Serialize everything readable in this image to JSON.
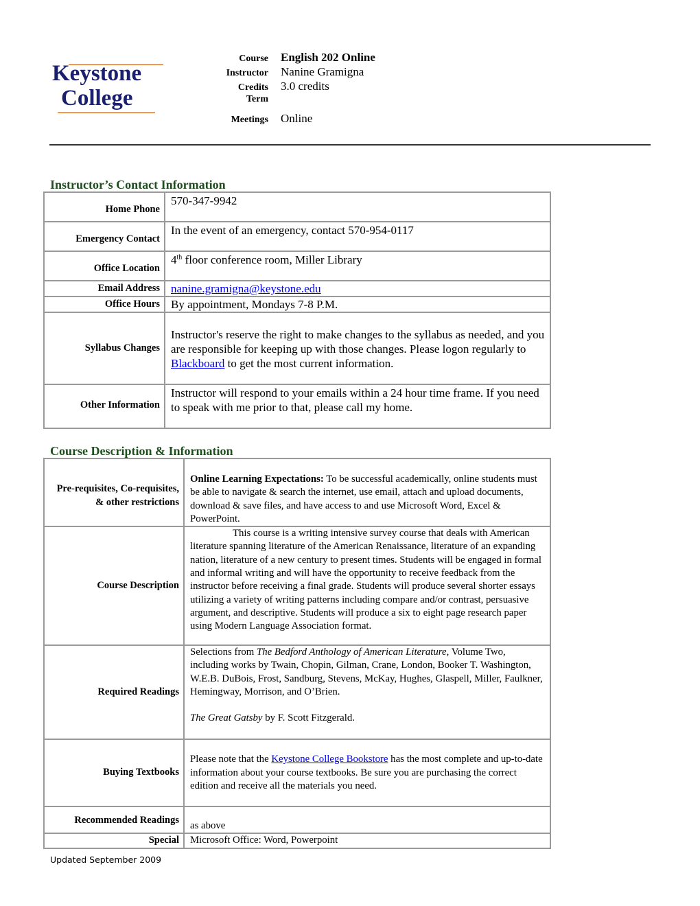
{
  "logo": {
    "line1": "Keystone",
    "line2": "College",
    "text_color": "#1a1f6e",
    "accent_color": "#f79646"
  },
  "course_meta": [
    {
      "label": "Course",
      "value": "English 202 Online"
    },
    {
      "label": "Instructor",
      "value": "Nanine Gramigna"
    },
    {
      "label": "Credits",
      "value": "3.0 credits"
    },
    {
      "label": "Term",
      "value": ""
    },
    {
      "label": "Meetings",
      "value": "Online"
    }
  ],
  "contact_section": {
    "title": "Instructor’s Contact Information",
    "rows": [
      {
        "label": "Home Phone",
        "value": "570-347-9942"
      },
      {
        "label": "Emergency Contact",
        "value": "In the event of an emergency, contact 570-954-0117"
      },
      {
        "label": "Office Location",
        "value_sup": "th",
        "value_pre": "4",
        "value_post": " floor conference room, Miller Library"
      },
      {
        "label": "Email Address",
        "link": "nanine.gramigna@keystone.edu"
      },
      {
        "label": "Office Hours",
        "value": "By appointment, Mondays 7-8 P.M."
      },
      {
        "label": "Syllabus Changes",
        "value_pre": "Instructor's reserve the right to make changes to the syllabus as needed, and you are responsible for keeping up with those changes. Please logon regularly to ",
        "link": "Blackboard",
        "value_post": " to get the most current information."
      },
      {
        "label": "Other Information",
        "value": "Instructor will respond to your emails within a 24 hour time frame. If  you need to speak with me prior to that, please call my home."
      }
    ]
  },
  "course_section": {
    "title": "Course Description & Information",
    "rows": [
      {
        "label": "Pre-requisites, Co-requisites, & other restrictions",
        "bold_lead": "Online Learning Expectations:",
        "value": " To be successful academically, online students must be able to navigate & search the internet, use email, attach and upload documents, download & save files, and have access to and use Microsoft Word, Excel & PowerPoint."
      },
      {
        "label": "Course Description",
        "value": "This course is a writing intensive survey course that deals with American literature spanning literature of the American Renaissance, literature of an expanding nation, literature of a new century to present times. Students will be engaged in formal and informal writing and will have the opportunity to receive feedback from the instructor before receiving a final grade. Students will produce several shorter essays utilizing a variety of writing patterns including compare and/or contrast, persuasive argument, and descriptive. Students will produce a six to eight page research paper using Modern Language Association format."
      },
      {
        "label": "Required Readings",
        "p1_pre": "Selections from ",
        "p1_italic": "The Bedford Anthology of American Literature",
        "p1_post": ", Volume Two, including works by Twain, Chopin, Gilman, Crane, London, Booker T. Washington, W.E.B. DuBois, Frost, Sandburg, Stevens, McKay, Hughes, Glaspell, Miller, Faulkner, Hemingway, Morrison, and O’Brien.",
        "p2_italic": "The Great Gatsby",
        "p2_post": " by F. Scott Fitzgerald."
      },
      {
        "label": "Buying Textbooks",
        "value_pre": "Please note that the ",
        "link": "Keystone College Bookstore",
        "value_post": " has the most complete and up-to-date information about your course textbooks. Be sure you are purchasing the correct edition and receive all the materials you need."
      },
      {
        "label": "Recommended Readings",
        "value": "as above"
      },
      {
        "label": "Special",
        "value": "Microsoft Office: Word, Powerpoint"
      }
    ]
  },
  "footer": "Updated September 2009"
}
